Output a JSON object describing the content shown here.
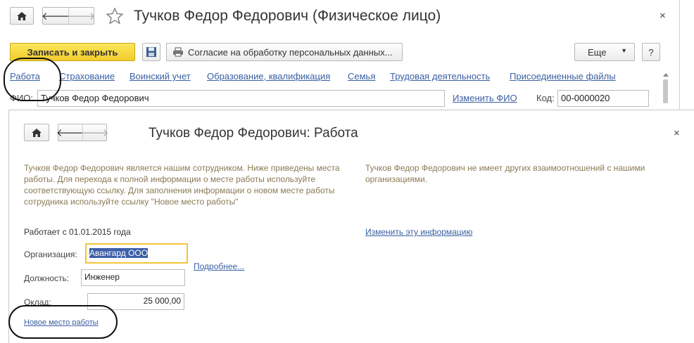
{
  "back_window": {
    "title": "Тучков Федор Федорович (Физическое лицо)",
    "close": "×",
    "toolbar": {
      "save_close": "Записать и закрыть",
      "consent": "Согласие на обработку персональных данных...",
      "more": "Еще",
      "help": "?"
    },
    "tabs": [
      {
        "label": "Работа"
      },
      {
        "label": "Страхование"
      },
      {
        "label": "Воинский учет"
      },
      {
        "label": "Образование, квалификация"
      },
      {
        "label": "Семья"
      },
      {
        "label": "Трудовая деятельность"
      },
      {
        "label": "Присоединенные файлы"
      }
    ],
    "fio_label": "ФИО:",
    "fio_value": "Тучков Федор Федорович",
    "change_fio": "Изменить ФИО",
    "code_label": "Код:",
    "code_value": "00-0000020"
  },
  "front_window": {
    "title": "Тучков Федор Федорович: Работа",
    "close": "×",
    "info_left": "Тучков Федор Федорович является нашим сотрудником. Ниже приведены места работы. Для перехода к полной информации о месте работы используйте соответствующую ссылку. Для заполнения информации о новом месте работы сотрудника используйте ссылку \"Новое место работы\"",
    "info_right": "Тучков Федор Федорович не имеет других взаимоотношений с нашими организациями.",
    "works_since": "Работает с 01.01.2015 года",
    "change_info": "Изменить эту информацию",
    "org_label": "Организация:",
    "org_value": "Авангард ООО",
    "details_link": "Подробнее...",
    "position_label": "Должность:",
    "position_value": "Инженер",
    "salary_label": "Оклад:",
    "salary_value": "25 000,00",
    "new_workplace_link": "Новое место работы"
  },
  "colors": {
    "accent_yellow": "#f2cc2c",
    "link_blue": "#3a5fa3",
    "info_text": "#8a7a55",
    "selection_blue": "#3d5fa8"
  },
  "icons": [
    "home-icon",
    "arrow-left-icon",
    "arrow-right-icon",
    "star-icon",
    "floppy-icon",
    "printer-icon",
    "dropdown-triangle-icon",
    "close-icon"
  ]
}
